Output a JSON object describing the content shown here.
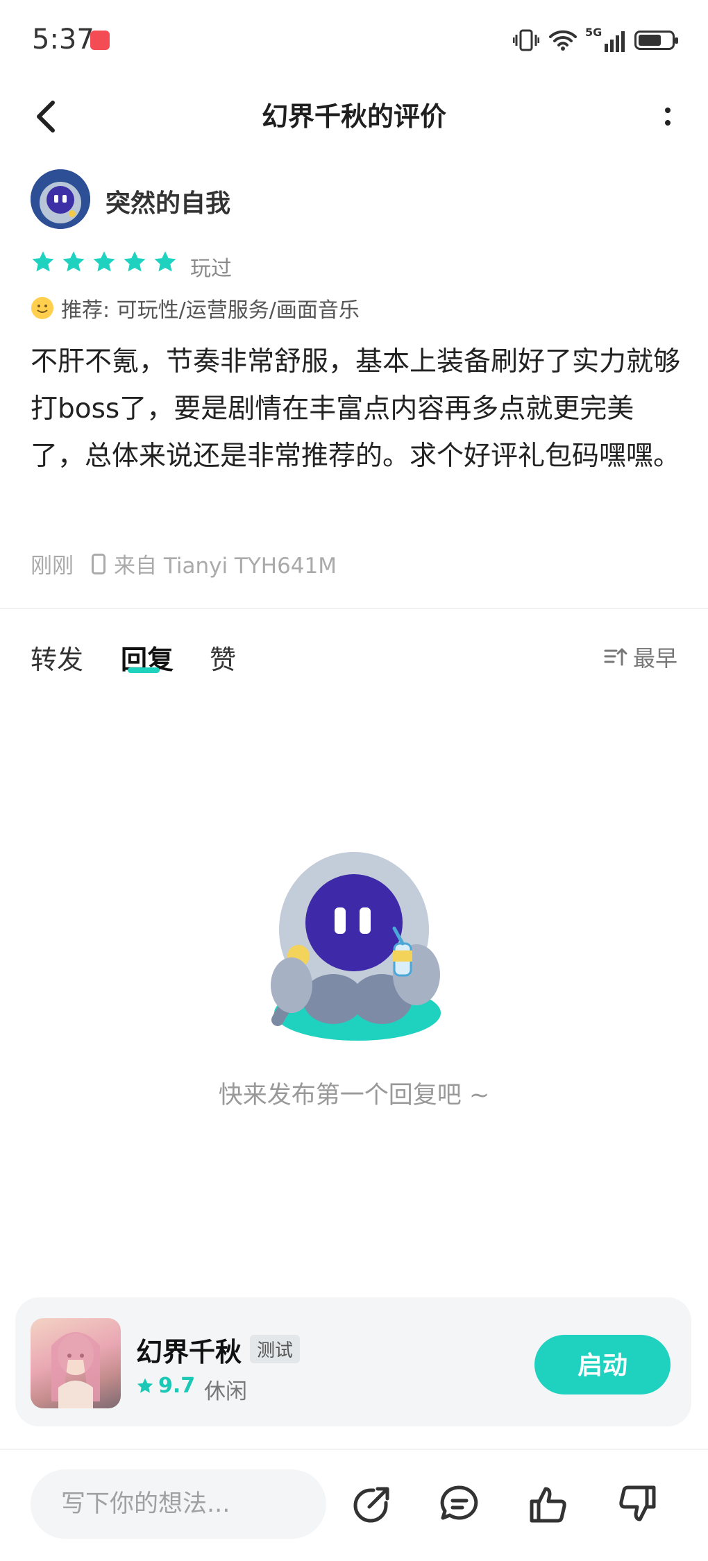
{
  "status_bar": {
    "time": "5:37",
    "network": "5G"
  },
  "nav": {
    "title": "幻界千秋的评价"
  },
  "review": {
    "username": "突然的自我",
    "rating": 5,
    "played_label": "玩过",
    "recommend_text": "推荐: 可玩性/运营服务/画面音乐",
    "content": "不肝不氪，节奏非常舒服，基本上装备刷好了实力就够打boss了，要是剧情在丰富点内容再多点就更完美了，总体来说还是非常推荐的。求个好评礼包码嘿嘿。",
    "time": "刚刚",
    "device": "来自 Tianyi TYH641M"
  },
  "tabs": [
    {
      "label": "转发"
    },
    {
      "label": "回复"
    },
    {
      "label": "赞"
    }
  ],
  "active_tab": "回复",
  "sort_label": "最早",
  "empty_state": {
    "text": "快来发布第一个回复吧 ~"
  },
  "game": {
    "name": "幻界千秋",
    "tag": "测试",
    "score": "9.7",
    "category": "休闲",
    "launch_label": "启动"
  },
  "bottom_bar": {
    "input_placeholder": "写下你的想法..."
  },
  "colors": {
    "accent": "#1fd2c0",
    "star": "#1fd2c0"
  }
}
